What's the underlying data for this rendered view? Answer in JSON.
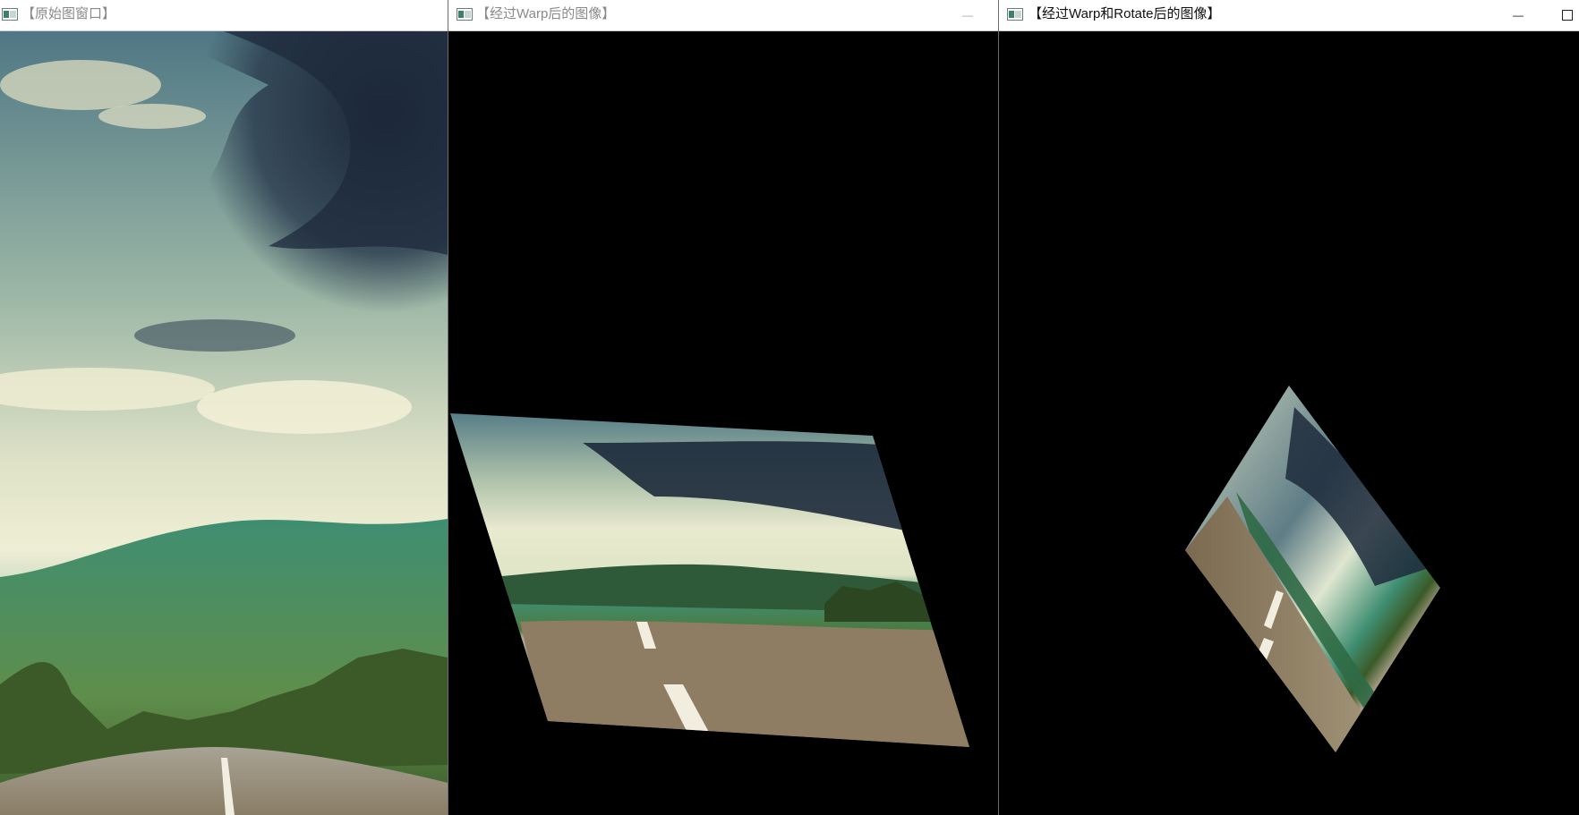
{
  "windows": [
    {
      "title": "【原始图窗口】",
      "state": "inactive"
    },
    {
      "title": "【经过Warp后的图像】",
      "state": "inactive",
      "minimize_glyph": "—"
    },
    {
      "title": "【经过Warp和Rotate后的图像】",
      "state": "active",
      "minimize_glyph": "—"
    }
  ],
  "icons": {
    "window": "app-window-icon",
    "minimize": "minimize-icon",
    "maximize": "maximize-icon"
  },
  "colors": {
    "sky_top": "#2f4a5c",
    "sky_light": "#e7ead4",
    "cloud_dark": "#1e2a3c",
    "hills": "#3f8a6f",
    "trees": "#37542a",
    "road": "#8f806a",
    "background": "#000000"
  }
}
